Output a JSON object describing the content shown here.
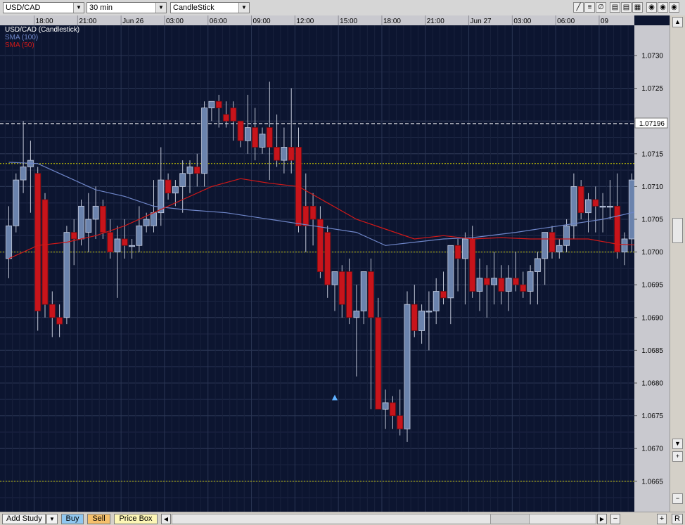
{
  "toolbar": {
    "symbol": "USD/CAD",
    "timeframe": "30 min",
    "chart_type": "CandleStick"
  },
  "bottom": {
    "add_study": "Add Study",
    "buy": "Buy",
    "sell": "Sell",
    "price_box": "Price Box",
    "r_label": "R"
  },
  "legend": {
    "main": "USD/CAD (Candlestick)",
    "sma100": "SMA (100)",
    "sma50": "SMA (50)"
  },
  "current_price": "1.07196",
  "colors": {
    "background": "#0c1530",
    "grid": "#2a3553",
    "up_candle": "#6b83ad",
    "down_candle": "#c8141b",
    "sma100": "#6f86c9",
    "sma50": "#d01818",
    "level_line": "#c9c900",
    "axis_bg": "#c9c9cf"
  },
  "chart_data": {
    "type": "candlestick",
    "y_axis": {
      "min": 1.066,
      "max": 1.0735,
      "ticks": [
        "1.0730",
        "1.0725",
        "1.0720",
        "1.0715",
        "1.0710",
        "1.0705",
        "1.0700",
        "1.0695",
        "1.0690",
        "1.0685",
        "1.0680",
        "1.0675",
        "1.0670",
        "1.0665"
      ]
    },
    "x_ticks": [
      {
        "label": "18:00",
        "idx": 4
      },
      {
        "label": "21:00",
        "idx": 10
      },
      {
        "label": "Jun 26",
        "idx": 16
      },
      {
        "label": "03:00",
        "idx": 22
      },
      {
        "label": "06:00",
        "idx": 28
      },
      {
        "label": "09:00",
        "idx": 34
      },
      {
        "label": "12:00",
        "idx": 40
      },
      {
        "label": "15:00",
        "idx": 46
      },
      {
        "label": "18:00",
        "idx": 52
      },
      {
        "label": "21:00",
        "idx": 58
      },
      {
        "label": "Jun 27",
        "idx": 64
      },
      {
        "label": "03:00",
        "idx": 70
      },
      {
        "label": "06:00",
        "idx": 76
      },
      {
        "label": "09",
        "idx": 82
      }
    ],
    "level_lines": [
      1.07135,
      1.07,
      1.0665
    ],
    "current_line": 1.07196,
    "marker": {
      "index": 45,
      "value": 1.06778,
      "shape": "up-triangle"
    },
    "candles": [
      [
        1.0699,
        1.0707,
        1.0696,
        1.0704
      ],
      [
        1.0704,
        1.0712,
        1.0703,
        1.0711
      ],
      [
        1.0711,
        1.072,
        1.0709,
        1.0713
      ],
      [
        1.0713,
        1.0717,
        1.0706,
        1.0714
      ],
      [
        1.0712,
        1.0713,
        1.0688,
        1.0691
      ],
      [
        1.0708,
        1.0709,
        1.069,
        1.0692
      ],
      [
        1.0692,
        1.0694,
        1.0687,
        1.069
      ],
      [
        1.069,
        1.0692,
        1.0687,
        1.0689
      ],
      [
        1.069,
        1.0704,
        1.0689,
        1.0703
      ],
      [
        1.0703,
        1.0705,
        1.0698,
        1.0702
      ],
      [
        1.0702,
        1.0708,
        1.0701,
        1.0707
      ],
      [
        1.0703,
        1.0709,
        1.07,
        1.0705
      ],
      [
        1.0705,
        1.071,
        1.0702,
        1.0707
      ],
      [
        1.0707,
        1.0708,
        1.0702,
        1.0703
      ],
      [
        1.0703,
        1.0705,
        1.0699,
        1.07
      ],
      [
        1.07,
        1.0704,
        1.0693,
        1.0702
      ],
      [
        1.0702,
        1.0705,
        1.0699,
        1.0701
      ],
      [
        1.0701,
        1.0702,
        1.0699,
        1.0701
      ],
      [
        1.0701,
        1.0707,
        1.07,
        1.0704
      ],
      [
        1.0704,
        1.0706,
        1.0703,
        1.0705
      ],
      [
        1.0704,
        1.0711,
        1.0703,
        1.0706
      ],
      [
        1.0706,
        1.0716,
        1.0704,
        1.0711
      ],
      [
        1.0711,
        1.0712,
        1.0708,
        1.0709
      ],
      [
        1.0709,
        1.0711,
        1.0707,
        1.071
      ],
      [
        1.071,
        1.0714,
        1.0706,
        1.0712
      ],
      [
        1.0712,
        1.0714,
        1.0709,
        1.0713
      ],
      [
        1.0713,
        1.0715,
        1.071,
        1.0712
      ],
      [
        1.0712,
        1.0723,
        1.071,
        1.0722
      ],
      [
        1.0722,
        1.0723,
        1.072,
        1.0723
      ],
      [
        1.0723,
        1.0724,
        1.0719,
        1.0722
      ],
      [
        1.0721,
        1.0723,
        1.0719,
        1.072
      ],
      [
        1.0722,
        1.0723,
        1.0717,
        1.072
      ],
      [
        1.072,
        1.072,
        1.0716,
        1.0717
      ],
      [
        1.0717,
        1.0724,
        1.0715,
        1.0719
      ],
      [
        1.0719,
        1.0722,
        1.0714,
        1.0716
      ],
      [
        1.0716,
        1.0719,
        1.0715,
        1.0718
      ],
      [
        1.0719,
        1.0726,
        1.0711,
        1.0716
      ],
      [
        1.0716,
        1.0721,
        1.0713,
        1.0714
      ],
      [
        1.0714,
        1.0719,
        1.0712,
        1.0716
      ],
      [
        1.0716,
        1.0725,
        1.0712,
        1.0714
      ],
      [
        1.0716,
        1.0719,
        1.0703,
        1.0704
      ],
      [
        1.0707,
        1.0712,
        1.07,
        1.0704
      ],
      [
        1.0707,
        1.0709,
        1.0701,
        1.0705
      ],
      [
        1.0705,
        1.0707,
        1.0696,
        1.0697
      ],
      [
        1.0703,
        1.0704,
        1.0693,
        1.0695
      ],
      [
        1.0695,
        1.0697,
        1.0691,
        1.0697
      ],
      [
        1.0697,
        1.0698,
        1.069,
        1.0692
      ],
      [
        1.0697,
        1.0699,
        1.0689,
        1.069
      ],
      [
        1.069,
        1.0695,
        1.0681,
        1.0691
      ],
      [
        1.0691,
        1.0697,
        1.0689,
        1.0697
      ],
      [
        1.0697,
        1.0699,
        1.0676,
        1.069
      ],
      [
        1.069,
        1.0693,
        1.0677,
        1.0676
      ],
      [
        1.0676,
        1.0679,
        1.0673,
        1.0677
      ],
      [
        1.0677,
        1.0678,
        1.0673,
        1.0675
      ],
      [
        1.0675,
        1.0679,
        1.0672,
        1.0673
      ],
      [
        1.0673,
        1.0694,
        1.0671,
        1.0692
      ],
      [
        1.0692,
        1.0695,
        1.0687,
        1.0688
      ],
      [
        1.0688,
        1.0692,
        1.0686,
        1.0691
      ],
      [
        1.0691,
        1.0694,
        1.0685,
        1.0691
      ],
      [
        1.0691,
        1.0696,
        1.0689,
        1.0694
      ],
      [
        1.0694,
        1.0697,
        1.0692,
        1.0693
      ],
      [
        1.0693,
        1.0699,
        1.0689,
        1.0701
      ],
      [
        1.0701,
        1.0702,
        1.0694,
        1.0699
      ],
      [
        1.0699,
        1.0703,
        1.0692,
        1.0702
      ],
      [
        1.0702,
        1.0704,
        1.0693,
        1.0694
      ],
      [
        1.0694,
        1.0699,
        1.0691,
        1.0696
      ],
      [
        1.0696,
        1.0698,
        1.069,
        1.0695
      ],
      [
        1.0695,
        1.07,
        1.0692,
        1.0696
      ],
      [
        1.0696,
        1.0698,
        1.0692,
        1.0694
      ],
      [
        1.0694,
        1.0698,
        1.0691,
        1.0696
      ],
      [
        1.0696,
        1.07,
        1.0694,
        1.0695
      ],
      [
        1.0695,
        1.0697,
        1.0693,
        1.0694
      ],
      [
        1.0694,
        1.0698,
        1.0692,
        1.0697
      ],
      [
        1.0697,
        1.07,
        1.0692,
        1.0699
      ],
      [
        1.0699,
        1.0703,
        1.0695,
        1.0703
      ],
      [
        1.0703,
        1.0704,
        1.0699,
        1.07
      ],
      [
        1.07,
        1.0702,
        1.0699,
        1.0701
      ],
      [
        1.0701,
        1.0705,
        1.07,
        1.0704
      ],
      [
        1.0704,
        1.0712,
        1.0702,
        1.071
      ],
      [
        1.071,
        1.0711,
        1.0705,
        1.0706
      ],
      [
        1.0706,
        1.0709,
        1.0703,
        1.0708
      ],
      [
        1.0708,
        1.071,
        1.0703,
        1.0707
      ],
      [
        1.0707,
        1.0709,
        1.0703,
        1.0707
      ],
      [
        1.0707,
        1.0711,
        1.0705,
        1.0707
      ],
      [
        1.0707,
        1.0712,
        1.0699,
        1.07
      ],
      [
        1.07,
        1.0703,
        1.0698,
        1.0702
      ],
      [
        1.0702,
        1.0712,
        1.07,
        1.0711
      ],
      [
        1.0711,
        1.0713,
        1.0706,
        1.0708
      ],
      [
        1.0708,
        1.0714,
        1.0707,
        1.0713
      ],
      [
        1.0713,
        1.0714,
        1.071,
        1.0712
      ],
      [
        1.0712,
        1.0714,
        1.0706,
        1.0708
      ],
      [
        1.0708,
        1.0713,
        1.0707,
        1.0713
      ],
      [
        1.0713,
        1.0722,
        1.0706,
        1.07196
      ]
    ],
    "sma100": [
      [
        0,
        1.07137
      ],
      [
        4,
        1.07135
      ],
      [
        8,
        1.07115
      ],
      [
        12,
        1.07095
      ],
      [
        16,
        1.07085
      ],
      [
        20,
        1.0707
      ],
      [
        24,
        1.07065
      ],
      [
        30,
        1.0706
      ],
      [
        36,
        1.0705
      ],
      [
        42,
        1.0704
      ],
      [
        48,
        1.0703
      ],
      [
        52,
        1.0701
      ],
      [
        56,
        1.07015
      ],
      [
        60,
        1.0702
      ],
      [
        64,
        1.07022
      ],
      [
        70,
        1.0703
      ],
      [
        76,
        1.0704
      ],
      [
        82,
        1.0705
      ],
      [
        86,
        1.0706
      ],
      [
        88,
        1.07065
      ]
    ],
    "sma50": [
      [
        0,
        1.0699
      ],
      [
        4,
        1.0701
      ],
      [
        8,
        1.07015
      ],
      [
        12,
        1.07025
      ],
      [
        16,
        1.0704
      ],
      [
        20,
        1.0706
      ],
      [
        24,
        1.0708
      ],
      [
        28,
        1.071
      ],
      [
        32,
        1.07112
      ],
      [
        36,
        1.07105
      ],
      [
        40,
        1.071
      ],
      [
        44,
        1.07075
      ],
      [
        48,
        1.0705
      ],
      [
        52,
        1.07035
      ],
      [
        56,
        1.0702
      ],
      [
        60,
        1.07025
      ],
      [
        64,
        1.0702
      ],
      [
        68,
        1.07022
      ],
      [
        72,
        1.0702
      ],
      [
        76,
        1.0702
      ],
      [
        80,
        1.0702
      ],
      [
        84,
        1.07012
      ],
      [
        88,
        1.0701
      ]
    ]
  }
}
